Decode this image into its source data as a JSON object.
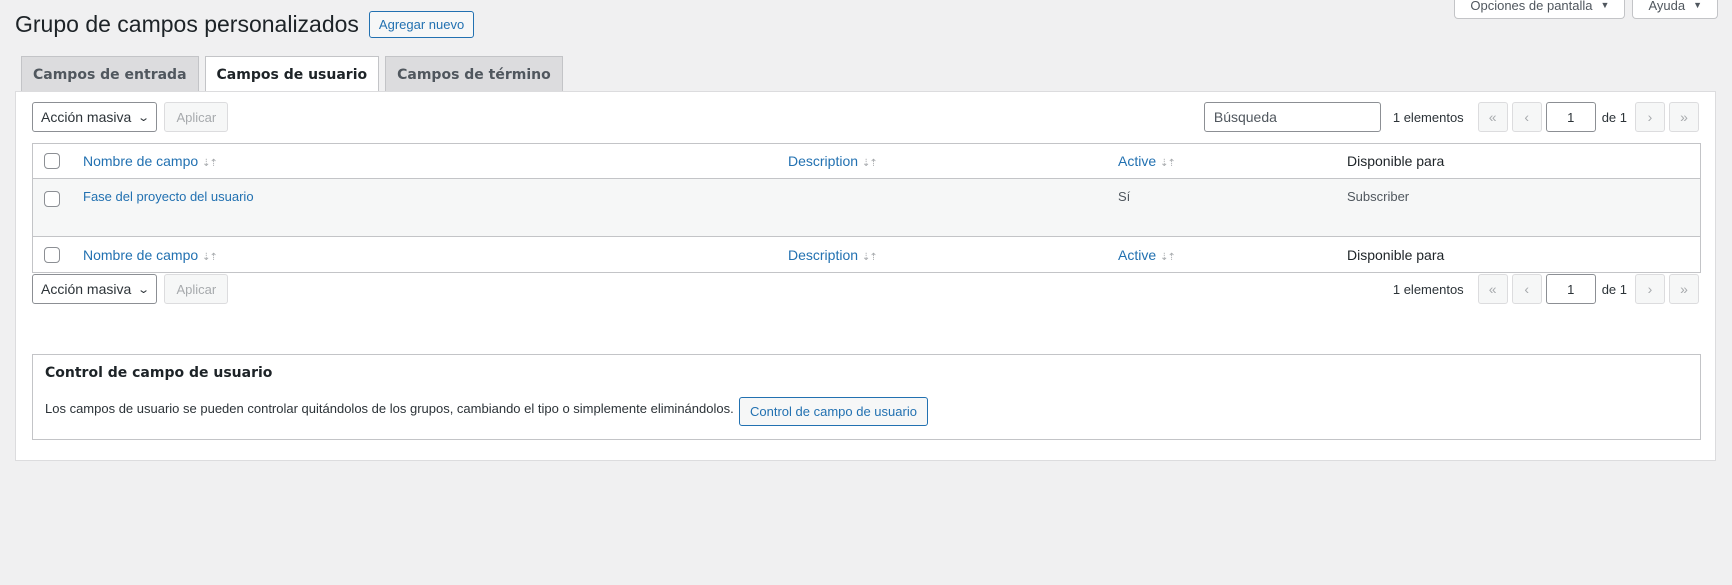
{
  "screen_meta": {
    "screen_options": "Opciones de pantalla",
    "help": "Ayuda"
  },
  "header": {
    "title": "Grupo de campos personalizados",
    "add_new": "Agregar nuevo"
  },
  "tabs": [
    {
      "label": "Campos de entrada",
      "active": false
    },
    {
      "label": "Campos de usuario",
      "active": true
    },
    {
      "label": "Campos de término",
      "active": false
    }
  ],
  "tablenav": {
    "bulk_action": "Acción masiva",
    "apply": "Aplicar",
    "search_placeholder": "Búsqueda",
    "items_count": "1 elementos",
    "first": "«",
    "prev": "‹",
    "current_page": "1",
    "of_total": "de 1",
    "next": "›",
    "last": "»"
  },
  "table": {
    "columns": [
      "Nombre de campo",
      "Description",
      "Active",
      "Disponible para"
    ],
    "sort_icon": "⇣⇡",
    "rows": [
      {
        "name": "Fase del proyecto del usuario",
        "description": "",
        "active": "Sí",
        "available_for": "Subscriber"
      }
    ]
  },
  "control": {
    "title": "Control de campo de usuario",
    "description": "Los campos de usuario se pueden controlar quitándolos de los grupos, cambiando el tipo o simplemente eliminándolos.",
    "button": "Control de campo de usuario"
  }
}
